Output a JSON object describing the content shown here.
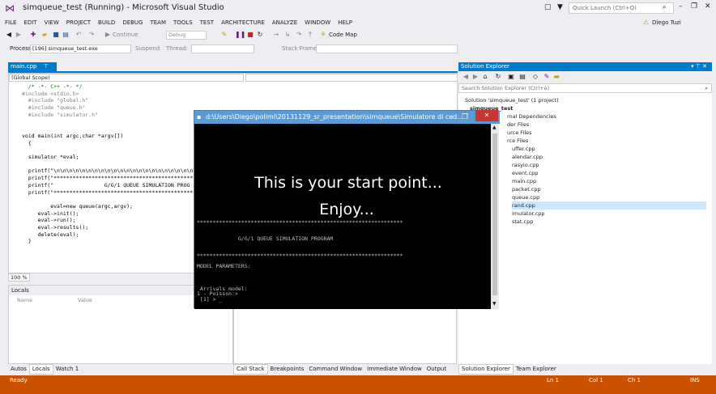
{
  "window": {
    "title": "simqueue_test (Running) - Microsoft Visual Studio",
    "quick_launch_placeholder": "Quick Launch (Ctrl+Q)",
    "user": "Diego Tuzi"
  },
  "menu": [
    "FILE",
    "EDIT",
    "VIEW",
    "PROJECT",
    "BUILD",
    "DEBUG",
    "TEAM",
    "TOOLS",
    "TEST",
    "ARCHITECTURE",
    "ANALYZE",
    "WINDOW",
    "HELP"
  ],
  "toolbar": {
    "continue_label": "Continue",
    "config": "Debug",
    "code_map_label": "Code Map",
    "process_label": "Process:",
    "process_value": "[196] simqueue_test.exe",
    "suspend_label": "Suspend",
    "thread_label": "Thread:",
    "stack_frame_label": "Stack Frame:"
  },
  "editor": {
    "tab_label": "main.cpp",
    "scope": "(Global Scope)",
    "zoom": "100 %",
    "lines": [
      {
        "t": "  /* -*- C++ -*- */",
        "c": "cm"
      },
      {
        "t": "#include <stdio.h>",
        "c": "pp"
      },
      {
        "t": "  #include \"global.h\"",
        "c": "pp"
      },
      {
        "t": "  #include \"queue.h\"",
        "c": "pp"
      },
      {
        "t": "  #include \"simulator.h\"",
        "c": "pp"
      },
      {
        "t": "",
        "c": ""
      },
      {
        "t": "",
        "c": ""
      },
      {
        "t": "void main(int argc,char *argv[])",
        "c": ""
      },
      {
        "t": "  {",
        "c": ""
      },
      {
        "t": "",
        "c": ""
      },
      {
        "t": "  simulator *eval;",
        "c": ""
      },
      {
        "t": "",
        "c": ""
      },
      {
        "t": "  printf(\"\\n\\n\\n\\n\\n\\n\\n\\n\\n\\n\\n\\n\\n\\n\\n\\n\\n\\n\\n\\n\\n\\n\\n",
        "c": ""
      },
      {
        "t": "  printf(\"*********************************************",
        "c": ""
      },
      {
        "t": "  printf(\"                G/G/1 QUEUE SIMULATION PROG",
        "c": ""
      },
      {
        "t": "  printf(\"*********************************************",
        "c": ""
      },
      {
        "t": "",
        "c": ""
      },
      {
        "t": "         eval=new queue(argc,argv);",
        "c": ""
      },
      {
        "t": "     eval->init();",
        "c": ""
      },
      {
        "t": "     eval->run();",
        "c": ""
      },
      {
        "t": "     eval->results();",
        "c": ""
      },
      {
        "t": "     delete(eval);",
        "c": ""
      },
      {
        "t": "  }",
        "c": ""
      }
    ]
  },
  "locals": {
    "title": "Locals",
    "col_name": "Name",
    "col_value": "Value",
    "tabs": [
      "Autos",
      "Locals",
      "Watch 1"
    ]
  },
  "mid_tabs": [
    "Call Stack",
    "Breakpoints",
    "Command Window",
    "Immediate Window",
    "Output"
  ],
  "solution_explorer": {
    "title": "Solution Explorer",
    "search_placeholder": "Search Solution Explorer (Ctrl+è)",
    "items": [
      "Solution 'simqueue_test' (1 project)",
      "simqueue_test",
      "rnal Dependencies",
      "der Files",
      "urce Files",
      "rce Files",
      "uffer.cpp",
      "alendar.cpp",
      "rasyio.cpp",
      "event.cpp",
      "main.cpp",
      "packet.cpp",
      "queue.cpp",
      "rand.cpp",
      "imulator.cpp",
      "stat.cpp"
    ],
    "tabs": [
      "Solution Explorer",
      "Team Explorer"
    ]
  },
  "console": {
    "title": "d:\\Users\\Diego\\polimi\\20131129_sr_presentation\\simqueue\\Simulatore di cod...",
    "overlay_line1": "This is your start point...",
    "overlay_line2": "Enjoy...",
    "lines": [
      "*****************************************************************",
      "",
      "",
      "             G/G/1 QUEUE SIMULATION PROGRAM",
      "",
      "",
      "*****************************************************************",
      "",
      "MODEL PARAMETERS:",
      "",
      "",
      "",
      " Arrivals model:",
      "1 - Poisson:>",
      " [1] > _"
    ]
  },
  "status": {
    "ready": "Ready",
    "ln": "Ln 1",
    "col": "Col 1",
    "ch": "Ch 1",
    "ins": "INS"
  }
}
